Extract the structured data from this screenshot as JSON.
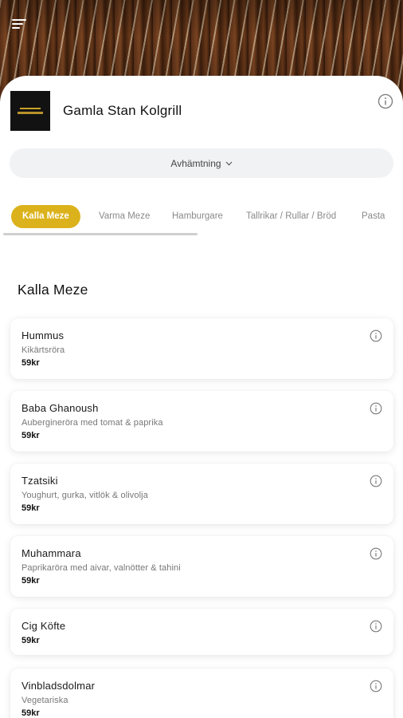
{
  "restaurant": {
    "name": "Gamla Stan Kolgrill",
    "logo_text": "KOLGRILL"
  },
  "order_mode": {
    "label": "Avhämtning",
    "icon": "chevron-down-icon"
  },
  "categories": [
    {
      "label": "Kalla Meze",
      "active": true
    },
    {
      "label": "Varma Meze",
      "active": false
    },
    {
      "label": "Hamburgare",
      "active": false
    },
    {
      "label": "Tallrikar / Rullar / Bröd",
      "active": false
    },
    {
      "label": "Pasta",
      "active": false
    }
  ],
  "section": {
    "title": "Kalla Meze"
  },
  "items": [
    {
      "name": "Hummus",
      "description": "Kikärtsröra",
      "price": "59kr"
    },
    {
      "name": "Baba Ghanoush",
      "description": "Aubergineröra med tomat & paprika",
      "price": "59kr"
    },
    {
      "name": "Tzatsiki",
      "description": "Youghurt, gurka, vitlök & olivolja",
      "price": "59kr"
    },
    {
      "name": "Muhammara",
      "description": "Paprikaröra med aivar, valnötter & tahini",
      "price": "59kr"
    },
    {
      "name": "Cig Köfte",
      "description": "",
      "price": "59kr"
    },
    {
      "name": "Vinbladsdolmar",
      "description": "Vegetariska",
      "price": "59kr"
    }
  ],
  "colors": {
    "accent": "#dbb21b",
    "pill_bg": "#f1f2f4",
    "text": "#1a1a1a",
    "muted": "#777777"
  },
  "icons": {
    "menu": "hamburger-menu-icon",
    "info": "info-icon"
  }
}
